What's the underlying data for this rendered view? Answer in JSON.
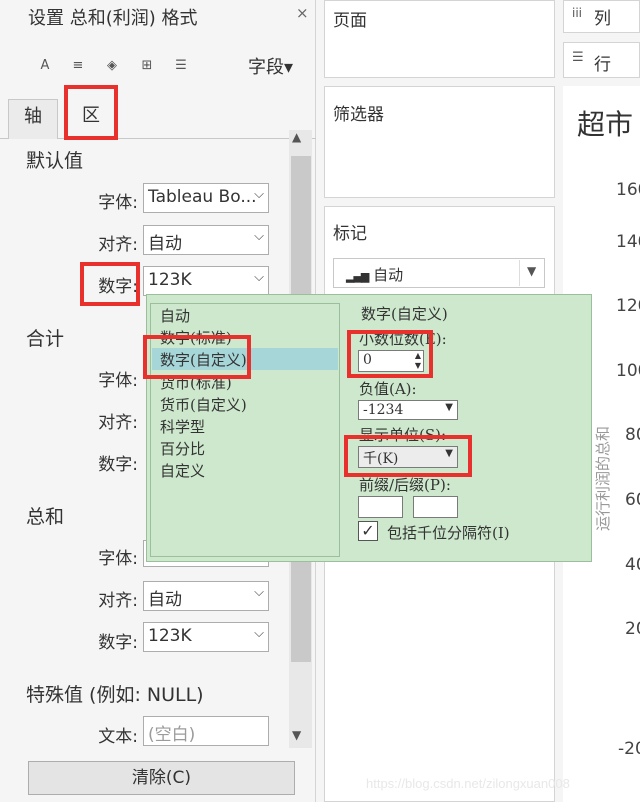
{
  "format_pane": {
    "title": "设置 总和(利润) 格式",
    "close_glyph": "×",
    "toolbar": {
      "font_glyph": "A",
      "align_glyph": "≡",
      "shading_glyph": "◈",
      "borders_glyph": "⊞",
      "lines_glyph": "☰",
      "fields_label": "字段▾"
    },
    "tabs": {
      "axis": "轴",
      "pane": "区"
    },
    "default_section": {
      "heading": "默认值",
      "font_label": "字体:",
      "font_value": "Tableau Bo...",
      "align_label": "对齐:",
      "align_value": "自动",
      "number_label": "数字:",
      "number_value": "123K"
    },
    "totals_section": {
      "heading": "合计",
      "font_label": "字体:",
      "align_label": "对齐:",
      "number_label": "数字:"
    },
    "grand_section": {
      "heading": "总和",
      "font_label": "字体:",
      "align_label": "对齐:",
      "align_value": "自动",
      "number_label": "数字:",
      "number_value": "123K"
    },
    "special_section": {
      "heading": "特殊值 (例如: NULL)",
      "text_label": "文本:",
      "text_placeholder": "(空白)"
    },
    "clear_button": "清除(C)",
    "chevron": "⌵",
    "scroll_up": "▲",
    "scroll_down": "▼"
  },
  "shelves": {
    "pages": "页面",
    "filters": "筛选器",
    "marks": "标记",
    "marks_type": "自动",
    "marks_chevron": "▼",
    "columns": "列",
    "rows": "行"
  },
  "viz": {
    "title_fragment": "超市",
    "axis_ticks": [
      "160",
      "140",
      "120",
      "100",
      "80",
      "60",
      "40",
      "20",
      "-20"
    ],
    "axis_title_fragment": "运行利润的总和"
  },
  "number_format_popup": {
    "list_items": [
      "自动",
      "数字(标准)",
      "数字(自定义)",
      "货币(标准)",
      "货币(自定义)",
      "科学型",
      "百分比",
      "自定义"
    ],
    "selected_index": 2,
    "panel_title": "数字(自定义)",
    "decimals_label": "小数位数(E):",
    "decimals_value": "0",
    "negative_label": "负值(A):",
    "negative_value": "-1234",
    "units_label": "显示单位(S):",
    "units_value": "千(K)",
    "prefix_suffix_label": "前缀/后缀(P):",
    "prefix_value": "",
    "suffix_value": "",
    "thousands_separator_label": "包括千位分隔符(I)",
    "thousands_separator_checked": "✓",
    "spin_up": "▲",
    "spin_down": "▼",
    "select_chevron": "▼"
  },
  "watermark": "https://blog.csdn.net/zilongxuan008",
  "colors": {
    "highlight_red": "#e8312c",
    "popup_green": "#cde8cd",
    "selection_cyan": "#a6d6d8",
    "pane_bg": "#f5f5f5"
  }
}
